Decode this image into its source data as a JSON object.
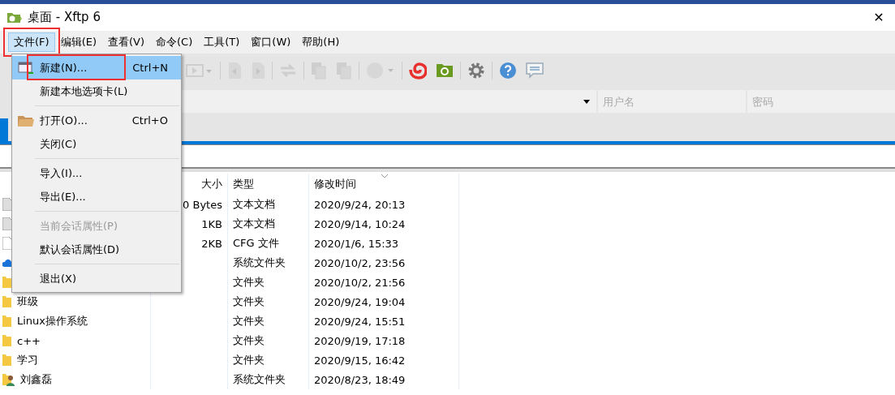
{
  "window": {
    "title": "桌面 - Xftp 6",
    "close": "✕"
  },
  "menubar": [
    {
      "label": "文件(F)",
      "selected": true,
      "annotated": true
    },
    {
      "label": "编辑(E)",
      "selected": false,
      "annotated": false
    },
    {
      "label": "查看(V)",
      "selected": false,
      "annotated": false
    },
    {
      "label": "命令(C)",
      "selected": false,
      "annotated": false
    },
    {
      "label": "工具(T)",
      "selected": false,
      "annotated": false
    },
    {
      "label": "窗口(W)",
      "selected": false,
      "annotated": false
    },
    {
      "label": "帮助(H)",
      "selected": false,
      "annotated": false
    }
  ],
  "menu": [
    {
      "kind": "item",
      "label": "新建(N)...",
      "shortcut": "Ctrl+N",
      "selected": true,
      "disabled": false,
      "annotated": true
    },
    {
      "kind": "item",
      "label": "新建本地选项卡(L)",
      "selected": false,
      "disabled": false,
      "annotated": false
    },
    {
      "kind": "separator"
    },
    {
      "kind": "item",
      "label": "打开(O)...",
      "shortcut": "Ctrl+O",
      "selected": false,
      "disabled": false,
      "annotated": false
    },
    {
      "kind": "item",
      "label": "关闭(C)",
      "selected": false,
      "disabled": false,
      "annotated": false
    },
    {
      "kind": "separator"
    },
    {
      "kind": "item",
      "label": "导入(I)...",
      "selected": false,
      "disabled": false,
      "annotated": false
    },
    {
      "kind": "item",
      "label": "导出(E)...",
      "selected": false,
      "disabled": false,
      "annotated": false
    },
    {
      "kind": "separator"
    },
    {
      "kind": "item",
      "label": "当前会话属性(P)",
      "selected": false,
      "disabled": true,
      "annotated": false
    },
    {
      "kind": "item",
      "label": "默认会话属性(D)",
      "selected": false,
      "disabled": false,
      "annotated": false
    },
    {
      "kind": "separator"
    },
    {
      "kind": "item",
      "label": "退出(X)",
      "selected": false,
      "disabled": false,
      "annotated": false
    }
  ],
  "toolbar": [
    {
      "kind": "play",
      "disabled": true
    },
    {
      "kind": "sep"
    },
    {
      "kind": "doc-left",
      "disabled": true
    },
    {
      "kind": "doc-right",
      "disabled": true
    },
    {
      "kind": "sep"
    },
    {
      "kind": "transfer",
      "disabled": true
    },
    {
      "kind": "sep"
    },
    {
      "kind": "copy",
      "disabled": true
    },
    {
      "kind": "paste",
      "disabled": true
    },
    {
      "kind": "sep"
    },
    {
      "kind": "circle",
      "disabled": true
    },
    {
      "kind": "sep"
    },
    {
      "kind": "swirl",
      "disabled": false
    },
    {
      "kind": "green-folder",
      "disabled": false
    },
    {
      "kind": "sep"
    },
    {
      "kind": "gear",
      "disabled": false
    },
    {
      "kind": "sep"
    },
    {
      "kind": "help",
      "disabled": false
    },
    {
      "kind": "chat",
      "disabled": false
    }
  ],
  "address_bar": {
    "username_placeholder": "用户名",
    "password_placeholder": "密码"
  },
  "file_list": {
    "columns": [
      {
        "label": "大小",
        "sorted": false
      },
      {
        "label": "类型",
        "sorted": false
      },
      {
        "label": "修改时间",
        "sorted": true
      }
    ],
    "rows": [
      {
        "kind": "file",
        "size": "0 Bytes",
        "type": "文本文档",
        "modified": "2020/9/24, 20:13"
      },
      {
        "kind": "file",
        "size": "1KB",
        "type": "文本文档",
        "modified": "2020/9/14, 10:24"
      },
      {
        "kind": "cfg",
        "size": "2KB",
        "type": "CFG 文件",
        "modified": "2020/1/6, 15:33"
      },
      {
        "kind": "cloud",
        "type": "系统文件夹",
        "modified": "2020/10/2, 23:56"
      },
      {
        "kind": "folder",
        "type": "文件夹",
        "modified": "2020/10/2, 21:56"
      },
      {
        "kind": "folder",
        "name": "班级",
        "type": "文件夹",
        "modified": "2020/9/24, 19:04"
      },
      {
        "kind": "folder",
        "name": "Linux操作系统",
        "type": "文件夹",
        "modified": "2020/9/24, 15:51"
      },
      {
        "kind": "folder",
        "name": "c++",
        "type": "文件夹",
        "modified": "2020/9/19, 17:18"
      },
      {
        "kind": "folder",
        "name": "学习",
        "type": "文件夹",
        "modified": "2020/9/15, 16:42"
      },
      {
        "kind": "user",
        "name": "刘鑫磊",
        "type": "系统文件夹",
        "modified": "2020/8/23, 18:49"
      }
    ]
  }
}
